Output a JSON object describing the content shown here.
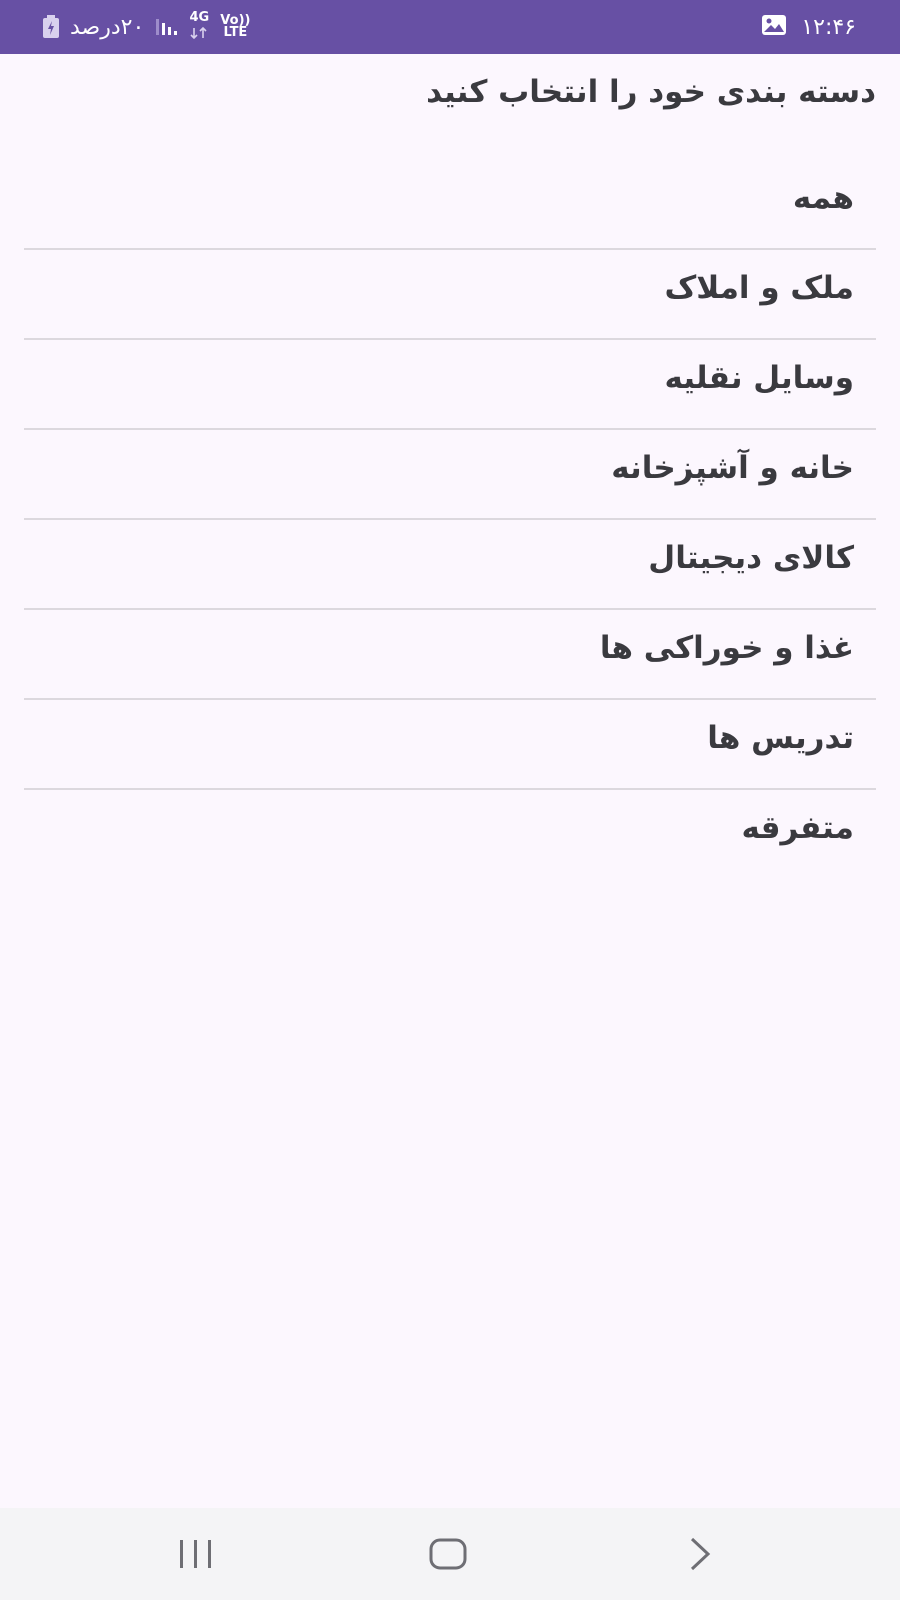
{
  "status_bar": {
    "time": "۱۲:۴۶",
    "battery": "۲۰درصد",
    "network": "4G",
    "volte_top": "Vo))",
    "volte_bottom": "LTE",
    "color": "#6750A4"
  },
  "page": {
    "title": "دسته بندی خود را انتخاب کنید"
  },
  "categories": [
    {
      "label": "همه"
    },
    {
      "label": "ملک و املاک"
    },
    {
      "label": "وسایل نقلیه"
    },
    {
      "label": "خانه و آشپزخانه"
    },
    {
      "label": "کالای دیجیتال"
    },
    {
      "label": "غذا و خوراکی ها"
    },
    {
      "label": "تدریس ها"
    },
    {
      "label": "متفرقه"
    }
  ],
  "nav_bar": {
    "icons": [
      "recent-apps-icon",
      "home-icon",
      "back-icon"
    ]
  }
}
